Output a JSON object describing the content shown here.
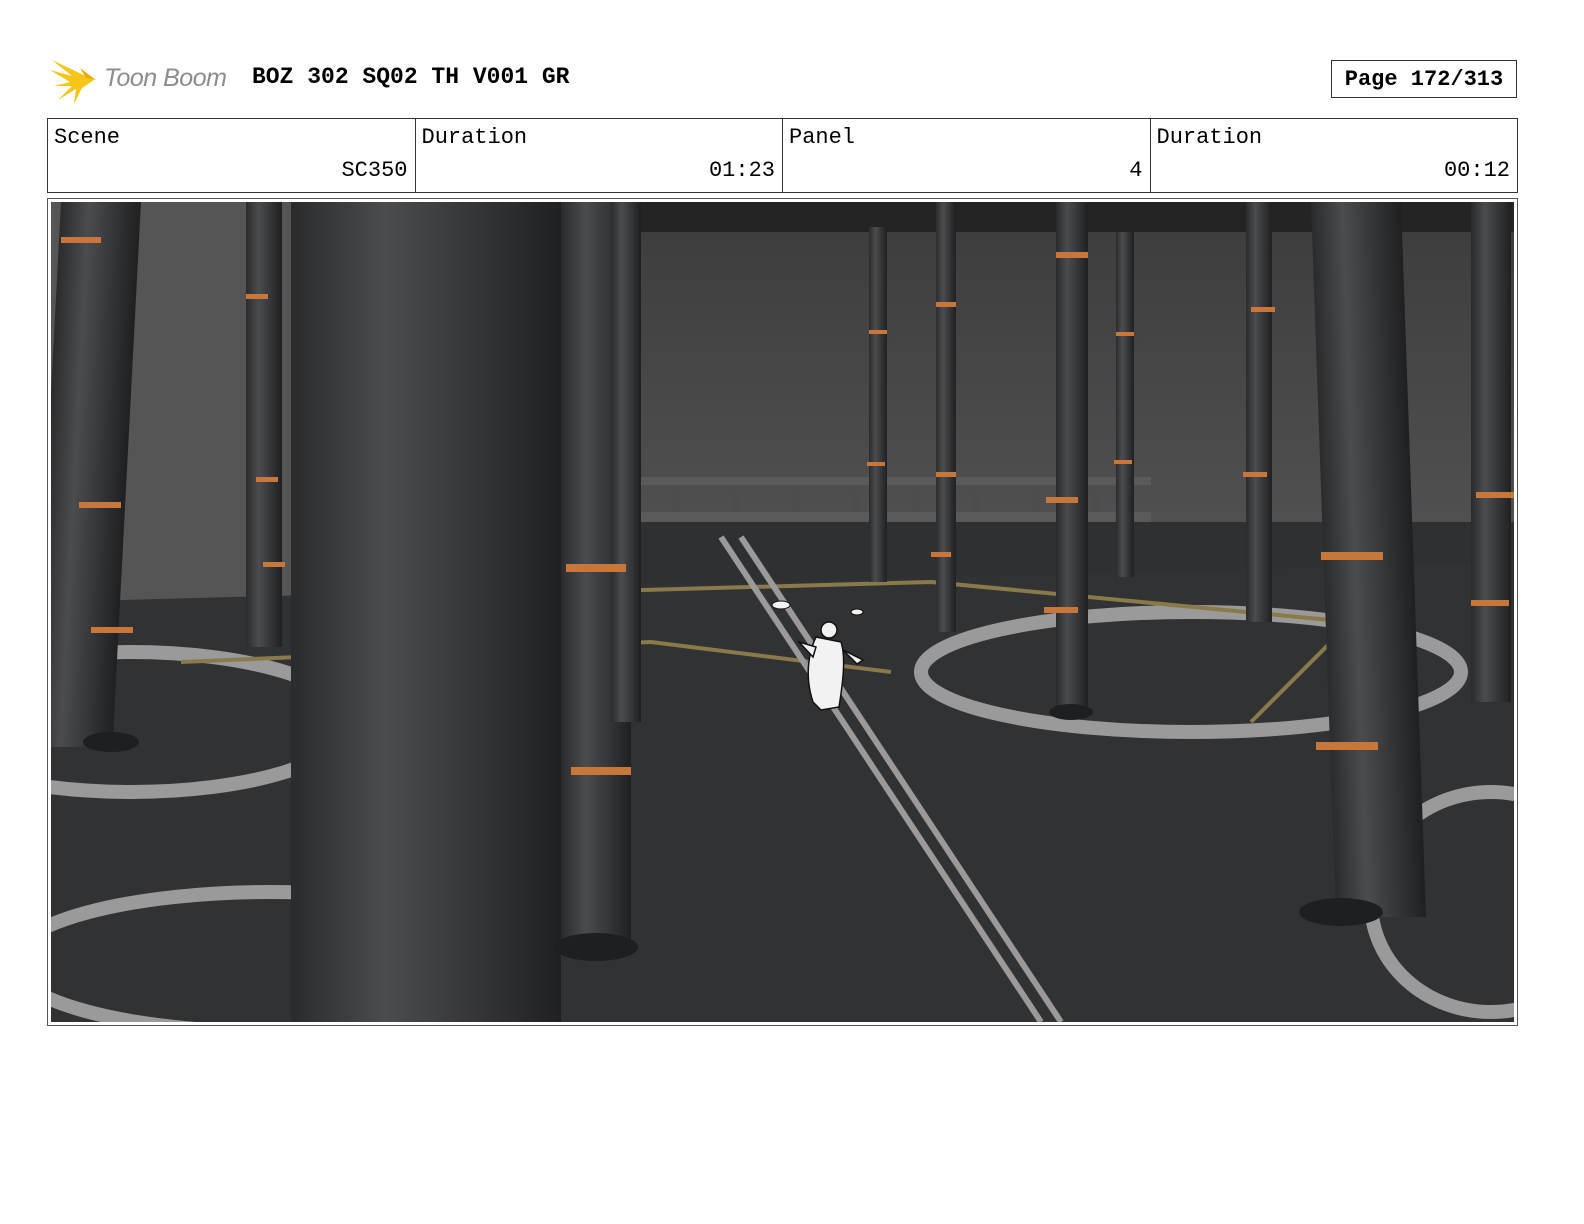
{
  "header": {
    "logo_text": "Toon Boom",
    "title": "BOZ 302 SQ02 TH V001 GR",
    "page": "Page 172/313"
  },
  "info": {
    "scene_label": "Scene",
    "scene_value": "SC350",
    "scene_duration_label": "Duration",
    "scene_duration_value": "01:23",
    "panel_label": "Panel",
    "panel_value": "4",
    "panel_duration_label": "Duration",
    "panel_duration_value": "00:12"
  },
  "panel": {
    "icon": "storyboard-panel-image",
    "scene_description": "",
    "colors": {
      "floor": "#2f3032",
      "wall": "#4a4a4b",
      "pillar": "#3a3b3d",
      "pillar_band": "#c8773a",
      "floor_lines": "#9a9a9a",
      "gold_lines": "#8a7a4a"
    }
  },
  "logo": {
    "icon": "toon-boom-burst-icon",
    "color": "#f5c518"
  }
}
